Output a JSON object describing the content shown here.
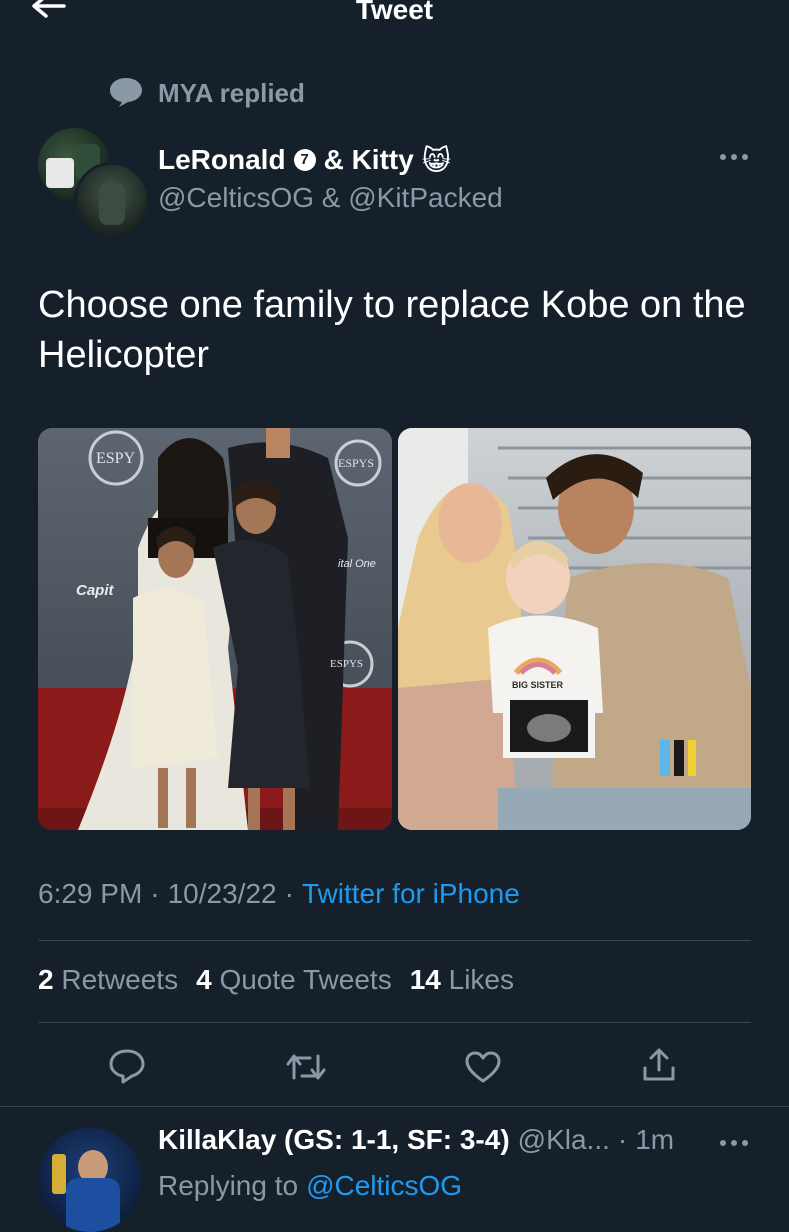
{
  "header": {
    "title": "Tweet",
    "back_icon": "arrow-left-icon"
  },
  "context": {
    "text": "MYA replied",
    "icon": "speech-bubble-icon"
  },
  "author": {
    "name": "LeRonald",
    "badge": "7",
    "and_text": "& Kitty",
    "emoji": "😸",
    "handle": "@CelticsOG & @KitPacked",
    "more_icon": "more-horizontal-icon"
  },
  "tweet": {
    "text": "Choose one family to replace Kobe on the Helicopter",
    "images": [
      {
        "name": "family-photo-left",
        "labels": [
          "ESPY",
          "ESPYS",
          "Capit",
          "ital One",
          "ESPYS"
        ]
      },
      {
        "name": "family-photo-right",
        "labels": [
          "BIG SISTER"
        ]
      }
    ]
  },
  "meta": {
    "time": "6:29 PM",
    "sep1": "·",
    "date": "10/23/22",
    "sep2": "·",
    "client": "Twitter for iPhone"
  },
  "stats": [
    {
      "count": "2",
      "label": "Retweets"
    },
    {
      "count": "4",
      "label": "Quote Tweets"
    },
    {
      "count": "14",
      "label": "Likes"
    }
  ],
  "actions": [
    {
      "name": "reply-button",
      "icon": "reply-icon"
    },
    {
      "name": "retweet-button",
      "icon": "retweet-icon"
    },
    {
      "name": "like-button",
      "icon": "heart-icon"
    },
    {
      "name": "share-button",
      "icon": "share-icon"
    }
  ],
  "reply": {
    "name": "KillaKlay (GS: 1-1, SF: 3-4)",
    "handle": "@Kla...",
    "sep": "·",
    "time": "1m",
    "replying_prefix": "Replying to",
    "replying_handle": "@CelticsOG"
  },
  "colors": {
    "background": "#15202b",
    "text": "#ffffff",
    "muted": "#8b98a5",
    "link": "#1d9bf0",
    "divider": "#38444d"
  }
}
